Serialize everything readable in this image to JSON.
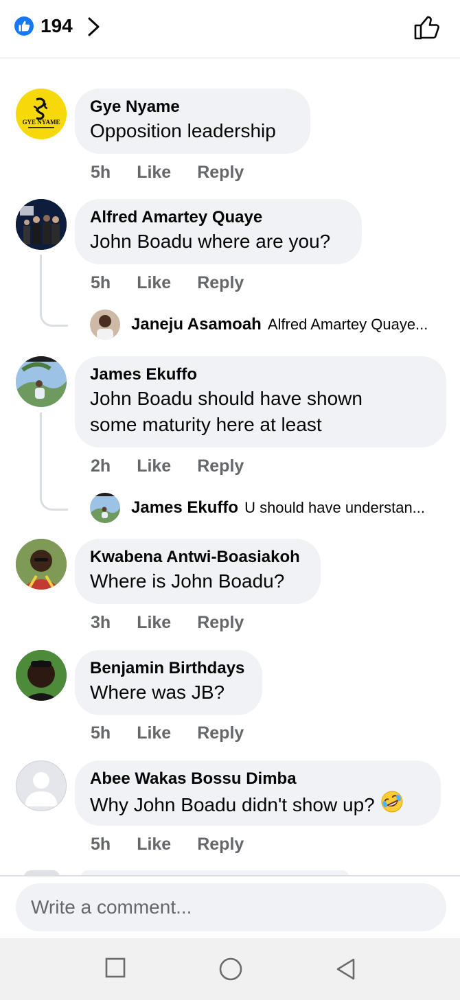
{
  "header": {
    "like_count": "194",
    "reaction_icon": "like-reaction-icon",
    "chevron_icon": "chevron-right-icon",
    "thumb_icon": "thumbs-up-outline-icon"
  },
  "actions": {
    "like": "Like",
    "reply": "Reply"
  },
  "comments": [
    {
      "author": "Gye Nyame",
      "lines": [
        "Opposition leadership"
      ],
      "time": "5h",
      "avatar_text": [
        "GYE NYAME"
      ]
    },
    {
      "author": "Alfred Amartey Quaye",
      "lines": [
        "John Boadu where are you?"
      ],
      "time": "5h",
      "reply": {
        "author": "Janeju Asamoah",
        "snippet": "Alfred Amartey Quaye..."
      }
    },
    {
      "author": "James Ekuffo",
      "lines": [
        "John Boadu should have shown",
        "some maturity here at least"
      ],
      "time": "2h",
      "reply": {
        "author": "James Ekuffo",
        "snippet": "U should have understan..."
      }
    },
    {
      "author": "Kwabena Antwi-Boasiakoh",
      "lines": [
        "Where is John Boadu?"
      ],
      "time": "3h"
    },
    {
      "author": "Benjamin Birthdays",
      "lines": [
        "Where was JB?"
      ],
      "time": "5h"
    },
    {
      "author": "Abee Wakas Bossu Dimba",
      "lines": [
        "Why John Boadu didn't show up?"
      ],
      "time": "5h",
      "emoji": "rolling-on-floor-laughing-emoji"
    }
  ],
  "composer": {
    "placeholder": "Write a comment..."
  },
  "navbar": {
    "recents_icon": "square-recents-icon",
    "home_icon": "circle-home-icon",
    "back_icon": "triangle-back-icon"
  },
  "colors": {
    "accent": "#1877f2",
    "bubble": "#f0f2f5",
    "meta": "#65676b",
    "gold": "#f5d90a"
  }
}
